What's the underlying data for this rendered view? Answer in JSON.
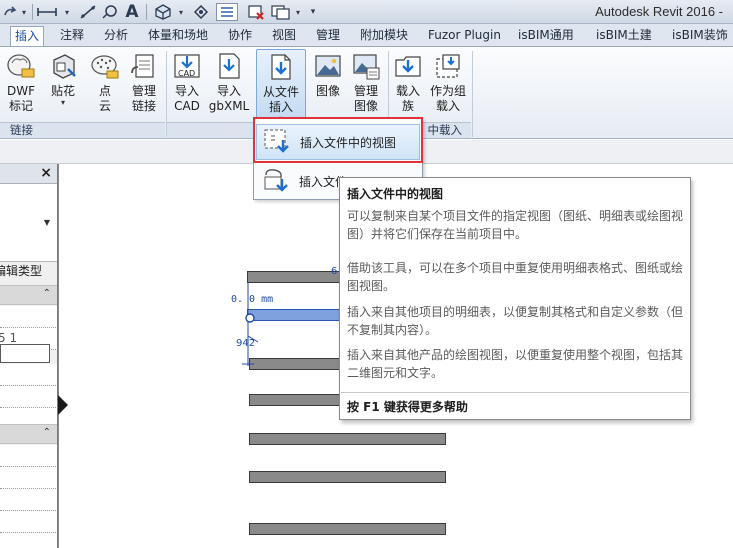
{
  "window": {
    "title": "Autodesk Revit 2016 -"
  },
  "quick_access": {
    "icons": [
      "redo-icon",
      "measure-icon",
      "dimension-icon",
      "tag-icon",
      "text-icon",
      "3d-view-icon",
      "section-icon",
      "thin-lines-icon",
      "close-hidden-icon",
      "switch-windows-icon",
      "customize-icon"
    ],
    "text_glyph": "A"
  },
  "tabs": [
    {
      "label": "插入",
      "active": true
    },
    {
      "label": "注释"
    },
    {
      "label": "分析"
    },
    {
      "label": "体量和场地"
    },
    {
      "label": "协作"
    },
    {
      "label": "视图"
    },
    {
      "label": "管理"
    },
    {
      "label": "附加模块"
    },
    {
      "label": "Fuzor Plugin"
    },
    {
      "label": "isBIM通用"
    },
    {
      "label": "isBIM土建"
    },
    {
      "label": "isBIM装饰"
    }
  ],
  "ribbon": {
    "buttons": [
      {
        "line1": "DWF",
        "line2": "标记",
        "icon": "dwf-markup-icon"
      },
      {
        "line1": "贴花",
        "line2": "",
        "icon": "decal-icon",
        "dropdown": true
      },
      {
        "line1": "点",
        "line2": "云",
        "icon": "point-cloud-icon"
      },
      {
        "line1": "管理",
        "line2": "链接",
        "icon": "manage-links-icon"
      },
      {
        "line1": "导入",
        "line2": "CAD",
        "icon": "import-cad-icon"
      },
      {
        "line1": "导入",
        "line2": "gbXML",
        "icon": "import-gbxml-icon"
      },
      {
        "line1": "从文件",
        "line2": "插入",
        "icon": "insert-from-file-icon",
        "dropdown": true
      },
      {
        "line1": "图像",
        "line2": "",
        "icon": "image-icon"
      },
      {
        "line1": "管理",
        "line2": "图像",
        "icon": "manage-images-icon"
      },
      {
        "line1": "载入",
        "line2": "族",
        "icon": "load-family-icon"
      },
      {
        "line1": "作为组",
        "line2": "载入",
        "icon": "load-as-group-icon"
      }
    ],
    "groups": [
      {
        "label": "链接"
      },
      {
        "label": "中载入"
      }
    ]
  },
  "dropdown": {
    "items": [
      {
        "label": "插入文件中的视图",
        "icon": "insert-views-icon"
      },
      {
        "label": "插入文件",
        "icon": "insert-2d-elements-icon"
      }
    ]
  },
  "tooltip": {
    "title": "插入文件中的视图",
    "paragraphs": [
      "可以复制来自某个项目文件的指定视图（图纸、明细表或绘图视图）并将它们保存在当前项目中。",
      "借助该工具，可以在多个项目中重复使用明细表格式、图纸或绘图视图。",
      "插入来自其他项目的明细表，以便复制其格式和自定义参数（但不复制其内容）。",
      "插入来自其他产品的绘图视图，以便重复使用整个视图，包括其二维图元和文字。"
    ],
    "help": "按 F1 键获得更多帮助"
  },
  "properties": {
    "close_glyph": "×",
    "edit_type": "编辑类型",
    "row_value": "5 1",
    "expand_glyph": "⌃"
  },
  "canvas": {
    "dimension_text": "0. 0  mm",
    "tag_942": "942",
    "tag_6": "6"
  }
}
